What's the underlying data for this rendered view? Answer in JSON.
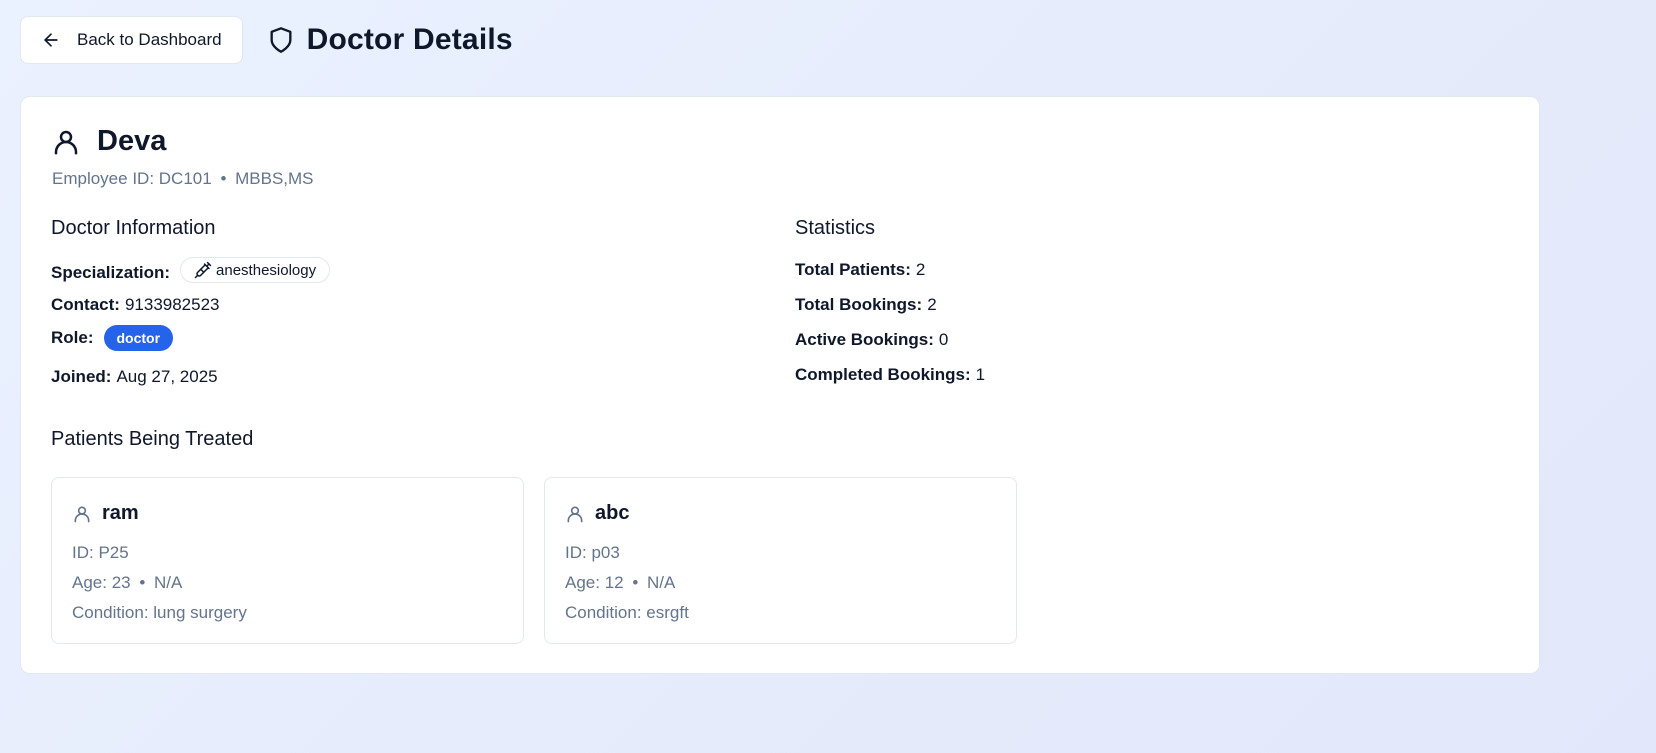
{
  "header": {
    "back_label": "Back to Dashboard",
    "title": "Doctor Details"
  },
  "doctor": {
    "name": "Deva",
    "employee_id_label": "Employee ID:",
    "employee_id": "DC101",
    "separator": "•",
    "qualification": "MBBS,MS"
  },
  "doctor_info": {
    "title": "Doctor Information",
    "specialization_label": "Specialization:",
    "specialization": "anesthesiology",
    "contact_label": "Contact:",
    "contact": "9133982523",
    "role_label": "Role:",
    "role": "doctor",
    "joined_label": "Joined:",
    "joined": "Aug 27, 2025"
  },
  "statistics": {
    "title": "Statistics",
    "items": [
      {
        "label": "Total Patients:",
        "value": "2"
      },
      {
        "label": "Total Bookings:",
        "value": "2"
      },
      {
        "label": "Active Bookings:",
        "value": "0"
      },
      {
        "label": "Completed Bookings:",
        "value": "1"
      }
    ]
  },
  "patients": {
    "title": "Patients Being Treated",
    "items": [
      {
        "name": "ram",
        "id_line": "ID: P25",
        "age": "Age: 23",
        "sep": "•",
        "gender": "N/A",
        "condition": "Condition: lung surgery"
      },
      {
        "name": "abc",
        "id_line": "ID: p03",
        "age": "Age: 12",
        "sep": "•",
        "gender": "N/A",
        "condition": "Condition: esrgft"
      }
    ]
  },
  "colors": {
    "accent": "#2563eb",
    "muted_text": "#64748b",
    "border": "#e2e8f0"
  },
  "icons": {
    "back": "arrow-left-icon",
    "title": "shield-icon",
    "doctor": "user-icon",
    "specialization": "syringe-icon",
    "patient": "user-icon"
  }
}
